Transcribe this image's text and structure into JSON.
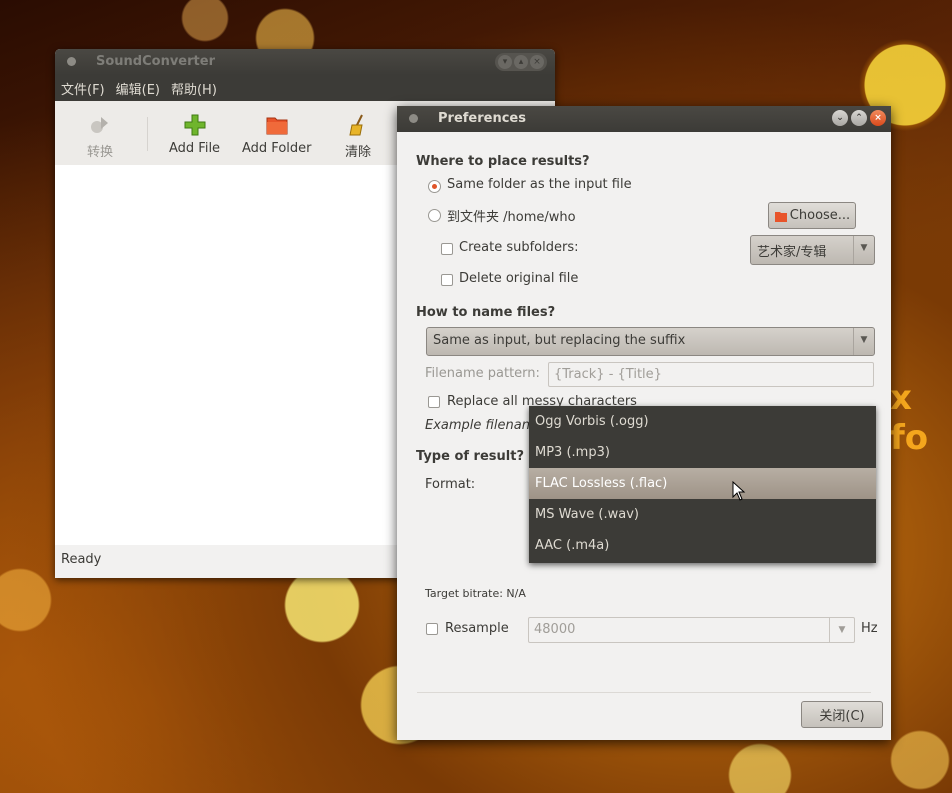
{
  "main_window": {
    "title": "SoundConverter",
    "menu": [
      "文件(F)",
      "编辑(E)",
      "帮助(H)"
    ],
    "toolbar": {
      "convert": "转换",
      "add_file": "Add File",
      "add_folder": "Add Folder",
      "clear": "清除"
    },
    "status": "Ready"
  },
  "background_text": "x fo",
  "preferences": {
    "title": "Preferences",
    "where_heading": "Where to place results?",
    "same_folder_label": "Same folder as the input file",
    "to_folder_label": "到文件夹 /home/who",
    "choose_button": "Choose...",
    "create_subfolders_label": "Create subfolders:",
    "subfolder_combo_value": "艺术家/专辑",
    "delete_original_label": "Delete original file",
    "naming_heading": "How to name files?",
    "naming_combo_value": "Same as input, but replacing the suffix",
    "filename_pattern_label": "Filename pattern:",
    "filename_pattern_value": "{Track} - {Title}",
    "replace_messy_label": "Replace all messy characters",
    "example_filename_label": "Example filenan",
    "type_heading": "Type of result?",
    "format_label": "Format:",
    "target_bitrate_label": "Target bitrate: N/A",
    "resample_label": "Resample",
    "resample_value": "48000",
    "resample_unit": "Hz",
    "close_button": "关闭(C)"
  },
  "format_dropdown": {
    "options": [
      "Ogg Vorbis (.ogg)",
      "MP3 (.mp3)",
      "FLAC Lossless (.flac)",
      "MS Wave (.wav)",
      "AAC (.m4a)"
    ],
    "selected": "FLAC Lossless (.flac)"
  },
  "colors": {
    "accent": "#e0552a",
    "titlebar": "#3c3b37",
    "dialog_bg": "#f2f1f0"
  }
}
